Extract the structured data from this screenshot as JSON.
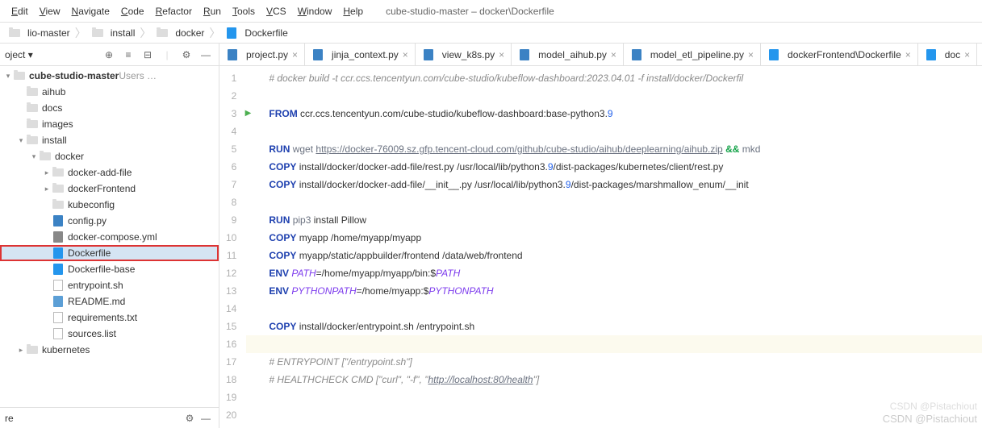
{
  "menu": {
    "items": [
      "Edit",
      "View",
      "Navigate",
      "Code",
      "Refactor",
      "Run",
      "Tools",
      "VCS",
      "Window",
      "Help"
    ],
    "title": "cube-studio-master – docker\\Dockerfile"
  },
  "breadcrumbs": [
    {
      "label": "lio-master",
      "icon": "folder"
    },
    {
      "label": "install",
      "icon": "folder"
    },
    {
      "label": "docker",
      "icon": "folder"
    },
    {
      "label": "Dockerfile",
      "icon": "docker"
    }
  ],
  "side": {
    "project_label": "oject",
    "dropdown": "▾"
  },
  "tree": [
    {
      "d": 0,
      "exp": true,
      "icon": "folder",
      "label": "cube-studio-master",
      "suffix": "  Users …",
      "bold": true
    },
    {
      "d": 1,
      "exp": null,
      "icon": "folder",
      "label": "aihub"
    },
    {
      "d": 1,
      "exp": null,
      "icon": "folder",
      "label": "docs"
    },
    {
      "d": 1,
      "exp": null,
      "icon": "folder",
      "label": "images"
    },
    {
      "d": 1,
      "exp": true,
      "icon": "folder",
      "label": "install"
    },
    {
      "d": 2,
      "exp": true,
      "icon": "folder",
      "label": "docker"
    },
    {
      "d": 3,
      "exp": false,
      "icon": "folder",
      "label": "docker-add-file"
    },
    {
      "d": 3,
      "exp": false,
      "icon": "folder",
      "label": "dockerFrontend"
    },
    {
      "d": 3,
      "exp": null,
      "icon": "folder",
      "label": "kubeconfig"
    },
    {
      "d": 3,
      "exp": null,
      "icon": "py",
      "label": "config.py"
    },
    {
      "d": 3,
      "exp": null,
      "icon": "yml",
      "label": "docker-compose.yml"
    },
    {
      "d": 3,
      "exp": null,
      "icon": "docker",
      "label": "Dockerfile",
      "sel": true,
      "hl": true
    },
    {
      "d": 3,
      "exp": null,
      "icon": "docker",
      "label": "Dockerfile-base"
    },
    {
      "d": 3,
      "exp": null,
      "icon": "file",
      "label": "entrypoint.sh"
    },
    {
      "d": 3,
      "exp": null,
      "icon": "md",
      "label": "README.md"
    },
    {
      "d": 3,
      "exp": null,
      "icon": "file",
      "label": "requirements.txt"
    },
    {
      "d": 3,
      "exp": null,
      "icon": "file",
      "label": "sources.list"
    },
    {
      "d": 1,
      "exp": false,
      "icon": "folder",
      "label": "kubernetes"
    }
  ],
  "footer_label": "re",
  "tabs": [
    {
      "icon": "py",
      "label": "project.py"
    },
    {
      "icon": "py",
      "label": "jinja_context.py"
    },
    {
      "icon": "py",
      "label": "view_k8s.py"
    },
    {
      "icon": "py",
      "label": "model_aihub.py"
    },
    {
      "icon": "py",
      "label": "model_etl_pipeline.py"
    },
    {
      "icon": "docker",
      "label": "dockerFrontend\\Dockerfile"
    },
    {
      "icon": "docker",
      "label": "doc"
    }
  ],
  "code_lines": [
    {
      "n": 1,
      "html": "<span class='c-cm'># docker build -t ccr.ccs.tencentyun.com/cube-studio/kubeflow-dashboard:2023.04.01 -f install/docker/Dockerfil</span>"
    },
    {
      "n": 2,
      "html": ""
    },
    {
      "n": 3,
      "mark": true,
      "html": "<span class='c-kw'>FROM</span> ccr.ccs.tencentyun.com/cube-studio/kubeflow-dashboard:base-python3.<span class='c-num'>9</span>"
    },
    {
      "n": 4,
      "html": ""
    },
    {
      "n": 5,
      "html": "<span class='c-kw'>RUN</span> <span class='c-cmd'>wget</span> <span class='c-url'>https://docker-76009.sz.gfp.tencent-cloud.com/github/cube-studio/aihub/deeplearning/aihub.zip</span> <span class='c-op'>&amp;&amp;</span> <span class='c-cmd'>mkd</span>"
    },
    {
      "n": 6,
      "html": "<span class='c-kw'>COPY</span> install/docker/docker-add-file/rest.py /usr/local/lib/python3.<span class='c-num'>9</span>/dist-packages/kubernetes/client/rest.py"
    },
    {
      "n": 7,
      "html": "<span class='c-kw'>COPY</span> install/docker/docker-add-file/__init__.py /usr/local/lib/python3.<span class='c-num'>9</span>/dist-packages/marshmallow_enum/__init"
    },
    {
      "n": 8,
      "html": ""
    },
    {
      "n": 9,
      "html": "<span class='c-kw'>RUN</span> <span class='c-cmd'>pip3</span> install Pillow"
    },
    {
      "n": 10,
      "html": "<span class='c-kw'>COPY</span> myapp /home/myapp/myapp"
    },
    {
      "n": 11,
      "html": "<span class='c-kw'>COPY</span> myapp/static/appbuilder/frontend /data/web/frontend"
    },
    {
      "n": 12,
      "html": "<span class='c-kw'>ENV</span> <span class='c-var'>PATH</span>=/home/myapp/myapp/bin:$<span class='c-var'>PATH</span>"
    },
    {
      "n": 13,
      "html": "<span class='c-kw'>ENV</span> <span class='c-var'>PYTHONPATH</span>=/home/myapp:$<span class='c-var'>PYTHONPATH</span>"
    },
    {
      "n": 14,
      "html": ""
    },
    {
      "n": 15,
      "html": "<span class='c-kw'>COPY</span> install/docker/entrypoint.sh /entrypoint.sh"
    },
    {
      "n": 16,
      "cur": true,
      "html": ""
    },
    {
      "n": 17,
      "html": "<span class='c-cm'># ENTRYPOINT [\"/entrypoint.sh\"]</span>"
    },
    {
      "n": 18,
      "html": "<span class='c-cm'># HEALTHCHECK CMD [\"curl\", \"-f\", \"<span class='c-url'>http://localhost:80/health</span>\"]</span>"
    },
    {
      "n": 19,
      "html": ""
    },
    {
      "n": 20,
      "html": ""
    }
  ],
  "watermark": "CSDN @Pistachiout",
  "watermark2": "CSDN @Pistachiout"
}
